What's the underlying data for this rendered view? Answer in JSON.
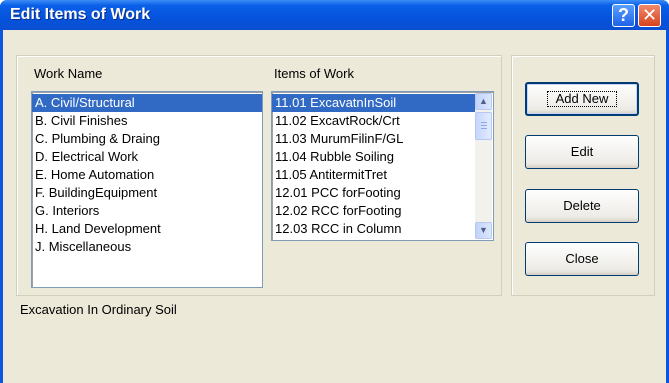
{
  "window": {
    "title": "Edit Items of Work"
  },
  "titlebar": {
    "help_label": "?",
    "close_label": "✕"
  },
  "work_names": {
    "header": "Work Name",
    "items": [
      "A. Civil/Structural",
      "B. Civil Finishes",
      "C. Plumbing & Draing",
      "D. Electrical Work",
      "E. Home Automation",
      "F. BuildingEquipment",
      "G. Interiors",
      "H. Land Development",
      "J. Miscellaneous"
    ],
    "selected_index": 0
  },
  "items_of_work": {
    "header": "Items of Work",
    "items": [
      "11.01 ExcavatnInSoil",
      "11.02 ExcavtRock/Crt",
      "11.03 MurumFilinF/GL",
      "11.04 Rubble Soiling",
      "11.05 AntitermitTret",
      "12.01 PCC forFooting",
      "12.02 RCC forFooting",
      "12.03 RCC in Column"
    ],
    "selected_index": 0,
    "scroll_up_icon": "scroll-up-icon",
    "scroll_down_icon": "scroll-down-icon"
  },
  "buttons": {
    "add_new": "Add New",
    "edit": "Edit",
    "delete": "Delete",
    "close": "Close"
  },
  "description": "Excavation In Ordinary Soil",
  "colors": {
    "titlebar": "#0a56e0",
    "selection": "#316ac5",
    "dialog_bg": "#ece9d8"
  }
}
